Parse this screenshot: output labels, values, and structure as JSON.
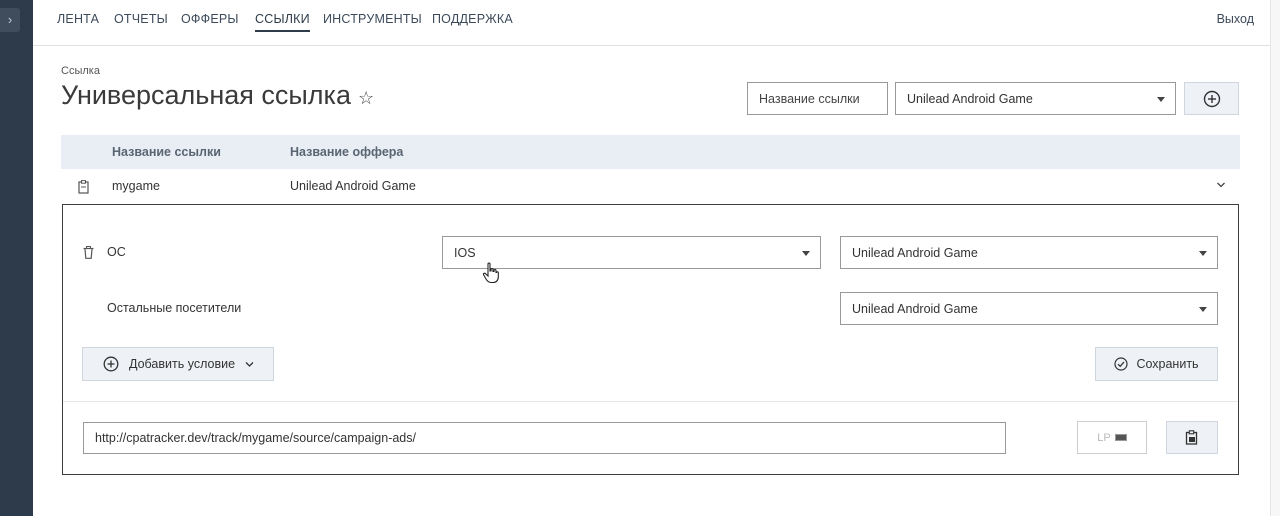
{
  "nav": {
    "items": [
      "ЛЕНТА",
      "ОТЧЕТЫ",
      "ОФФЕРЫ",
      "ССЫЛКИ",
      "ИНСТРУМЕНТЫ",
      "ПОДДЕРЖКА"
    ],
    "active": "ССЫЛКИ",
    "logout": "Выход"
  },
  "header": {
    "breadcrumb": "Ссылка",
    "title": "Универсальная ссылка",
    "name_input_placeholder": "Название ссылки",
    "offer_select_value": "Unilead Android Game"
  },
  "table": {
    "columns": [
      "Название ссылки",
      "Название оффера"
    ],
    "rows": [
      {
        "name": "mygame",
        "offer": "Unilead Android Game"
      }
    ]
  },
  "panel": {
    "condition": {
      "label": "ОС",
      "value": "IOS",
      "offer": "Unilead Android Game"
    },
    "others": {
      "label": "Остальные посетители",
      "offer": "Unilead Android Game"
    },
    "add_condition_label": "Добавить условие",
    "save_label": "Сохранить",
    "url": "http://cpatracker.dev/track/mygame/source/campaign-ads/",
    "lp_label": "LP"
  },
  "colors": {
    "sidebar": "#2e3b4a",
    "table_header": "#e9eef4",
    "button_bg": "#eef1f5"
  }
}
